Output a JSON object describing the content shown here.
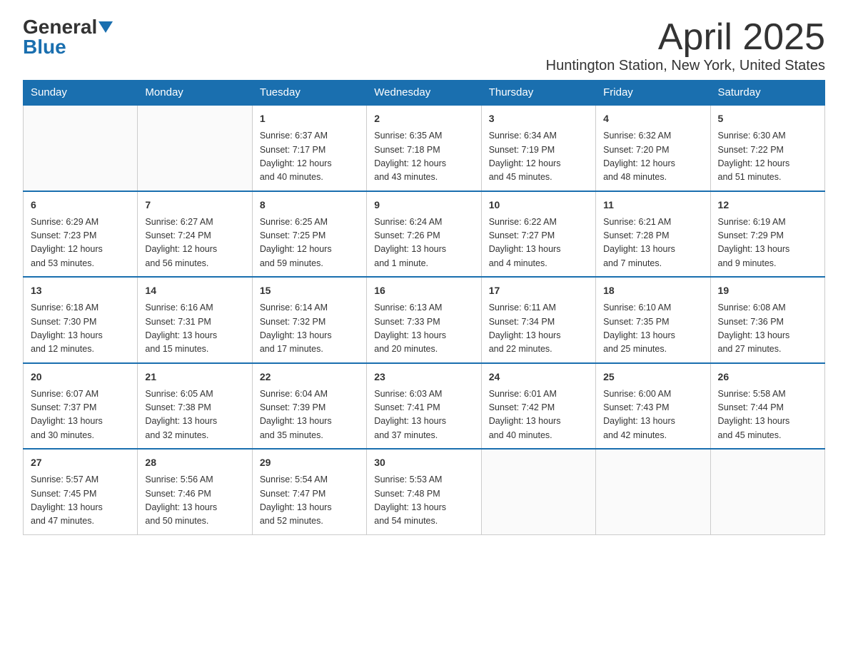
{
  "header": {
    "logo_general": "General",
    "logo_blue": "Blue",
    "month_title": "April 2025",
    "subtitle": "Huntington Station, New York, United States"
  },
  "days_of_week": [
    "Sunday",
    "Monday",
    "Tuesday",
    "Wednesday",
    "Thursday",
    "Friday",
    "Saturday"
  ],
  "weeks": [
    [
      {
        "day": "",
        "info": ""
      },
      {
        "day": "",
        "info": ""
      },
      {
        "day": "1",
        "info": "Sunrise: 6:37 AM\nSunset: 7:17 PM\nDaylight: 12 hours\nand 40 minutes."
      },
      {
        "day": "2",
        "info": "Sunrise: 6:35 AM\nSunset: 7:18 PM\nDaylight: 12 hours\nand 43 minutes."
      },
      {
        "day": "3",
        "info": "Sunrise: 6:34 AM\nSunset: 7:19 PM\nDaylight: 12 hours\nand 45 minutes."
      },
      {
        "day": "4",
        "info": "Sunrise: 6:32 AM\nSunset: 7:20 PM\nDaylight: 12 hours\nand 48 minutes."
      },
      {
        "day": "5",
        "info": "Sunrise: 6:30 AM\nSunset: 7:22 PM\nDaylight: 12 hours\nand 51 minutes."
      }
    ],
    [
      {
        "day": "6",
        "info": "Sunrise: 6:29 AM\nSunset: 7:23 PM\nDaylight: 12 hours\nand 53 minutes."
      },
      {
        "day": "7",
        "info": "Sunrise: 6:27 AM\nSunset: 7:24 PM\nDaylight: 12 hours\nand 56 minutes."
      },
      {
        "day": "8",
        "info": "Sunrise: 6:25 AM\nSunset: 7:25 PM\nDaylight: 12 hours\nand 59 minutes."
      },
      {
        "day": "9",
        "info": "Sunrise: 6:24 AM\nSunset: 7:26 PM\nDaylight: 13 hours\nand 1 minute."
      },
      {
        "day": "10",
        "info": "Sunrise: 6:22 AM\nSunset: 7:27 PM\nDaylight: 13 hours\nand 4 minutes."
      },
      {
        "day": "11",
        "info": "Sunrise: 6:21 AM\nSunset: 7:28 PM\nDaylight: 13 hours\nand 7 minutes."
      },
      {
        "day": "12",
        "info": "Sunrise: 6:19 AM\nSunset: 7:29 PM\nDaylight: 13 hours\nand 9 minutes."
      }
    ],
    [
      {
        "day": "13",
        "info": "Sunrise: 6:18 AM\nSunset: 7:30 PM\nDaylight: 13 hours\nand 12 minutes."
      },
      {
        "day": "14",
        "info": "Sunrise: 6:16 AM\nSunset: 7:31 PM\nDaylight: 13 hours\nand 15 minutes."
      },
      {
        "day": "15",
        "info": "Sunrise: 6:14 AM\nSunset: 7:32 PM\nDaylight: 13 hours\nand 17 minutes."
      },
      {
        "day": "16",
        "info": "Sunrise: 6:13 AM\nSunset: 7:33 PM\nDaylight: 13 hours\nand 20 minutes."
      },
      {
        "day": "17",
        "info": "Sunrise: 6:11 AM\nSunset: 7:34 PM\nDaylight: 13 hours\nand 22 minutes."
      },
      {
        "day": "18",
        "info": "Sunrise: 6:10 AM\nSunset: 7:35 PM\nDaylight: 13 hours\nand 25 minutes."
      },
      {
        "day": "19",
        "info": "Sunrise: 6:08 AM\nSunset: 7:36 PM\nDaylight: 13 hours\nand 27 minutes."
      }
    ],
    [
      {
        "day": "20",
        "info": "Sunrise: 6:07 AM\nSunset: 7:37 PM\nDaylight: 13 hours\nand 30 minutes."
      },
      {
        "day": "21",
        "info": "Sunrise: 6:05 AM\nSunset: 7:38 PM\nDaylight: 13 hours\nand 32 minutes."
      },
      {
        "day": "22",
        "info": "Sunrise: 6:04 AM\nSunset: 7:39 PM\nDaylight: 13 hours\nand 35 minutes."
      },
      {
        "day": "23",
        "info": "Sunrise: 6:03 AM\nSunset: 7:41 PM\nDaylight: 13 hours\nand 37 minutes."
      },
      {
        "day": "24",
        "info": "Sunrise: 6:01 AM\nSunset: 7:42 PM\nDaylight: 13 hours\nand 40 minutes."
      },
      {
        "day": "25",
        "info": "Sunrise: 6:00 AM\nSunset: 7:43 PM\nDaylight: 13 hours\nand 42 minutes."
      },
      {
        "day": "26",
        "info": "Sunrise: 5:58 AM\nSunset: 7:44 PM\nDaylight: 13 hours\nand 45 minutes."
      }
    ],
    [
      {
        "day": "27",
        "info": "Sunrise: 5:57 AM\nSunset: 7:45 PM\nDaylight: 13 hours\nand 47 minutes."
      },
      {
        "day": "28",
        "info": "Sunrise: 5:56 AM\nSunset: 7:46 PM\nDaylight: 13 hours\nand 50 minutes."
      },
      {
        "day": "29",
        "info": "Sunrise: 5:54 AM\nSunset: 7:47 PM\nDaylight: 13 hours\nand 52 minutes."
      },
      {
        "day": "30",
        "info": "Sunrise: 5:53 AM\nSunset: 7:48 PM\nDaylight: 13 hours\nand 54 minutes."
      },
      {
        "day": "",
        "info": ""
      },
      {
        "day": "",
        "info": ""
      },
      {
        "day": "",
        "info": ""
      }
    ]
  ],
  "colors": {
    "header_bg": "#1a6faf",
    "header_text": "#ffffff",
    "border": "#ccc",
    "logo_blue": "#1a6faf",
    "text": "#333333"
  }
}
